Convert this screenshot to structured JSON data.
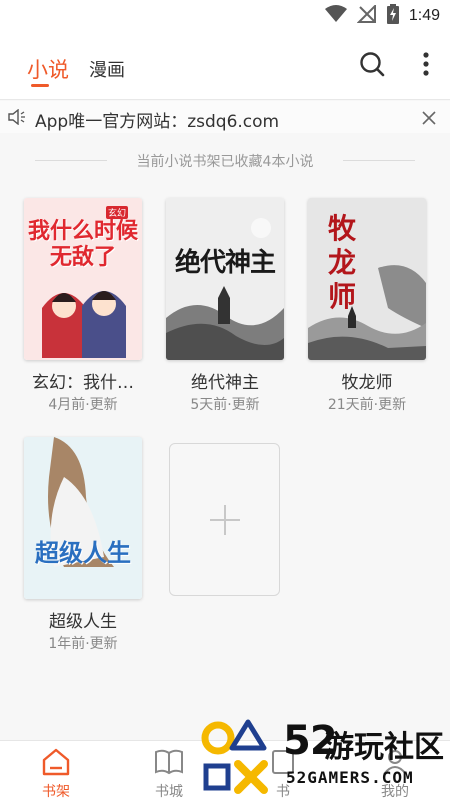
{
  "status_bar": {
    "time": "1:49",
    "icons": [
      "wifi-icon",
      "no-signal-icon",
      "battery-charging-icon"
    ]
  },
  "header": {
    "tabs": [
      {
        "label": "小说",
        "active": true
      },
      {
        "label": "漫画",
        "active": false
      }
    ],
    "icons": [
      "search-icon",
      "more-vertical-icon"
    ]
  },
  "notice": {
    "icon": "speaker-icon",
    "text": "App唯一官方网站：zsdq6.com",
    "close_icon": "close-icon"
  },
  "shelf": {
    "summary": "当前小说书架已收藏4本小说",
    "books": [
      {
        "title": "玄幻：我什…",
        "status": "4月前·更新",
        "cover_text": "我什么时候无敌了",
        "cover_badge": "玄幻"
      },
      {
        "title": "绝代神主",
        "status": "5天前·更新",
        "cover_text": "绝代神主"
      },
      {
        "title": "牧龙师",
        "status": "21天前·更新",
        "cover_text": "牧龙师"
      },
      {
        "title": "超级人生",
        "status": "1年前·更新",
        "cover_text": "超级人生"
      }
    ],
    "add_icon": "plus-icon"
  },
  "bottom_nav": [
    {
      "label": "书架",
      "icon": "home-icon",
      "active": true
    },
    {
      "label": "书城",
      "icon": "book-icon",
      "active": false
    },
    {
      "label": "书",
      "icon": "list-icon",
      "active": false
    },
    {
      "label": "我的",
      "icon": "user-icon",
      "active": false
    }
  ],
  "watermark": {
    "number": "52",
    "name": "游玩社区",
    "site": "52GAMERS.COM"
  },
  "colors": {
    "accent": "#ef5a2a",
    "text": "#333333",
    "muted": "#888888",
    "background": "#f7f7f7"
  }
}
